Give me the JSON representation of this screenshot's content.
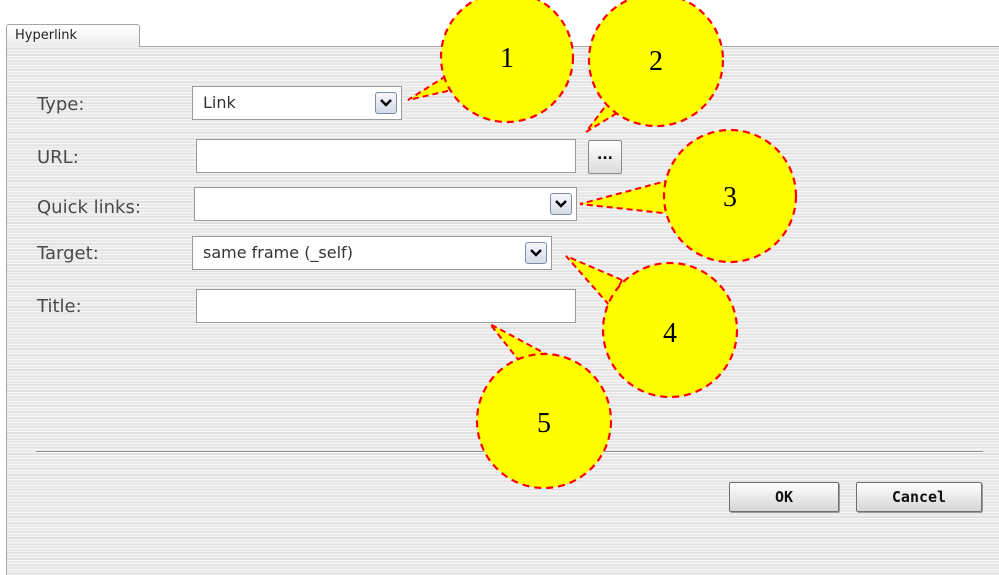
{
  "tab": {
    "label": "Hyperlink"
  },
  "form": {
    "type": {
      "label": "Type:",
      "value": "Link"
    },
    "url": {
      "label": "URL:",
      "value": "",
      "browse_label": "..."
    },
    "quick_links": {
      "label": "Quick links:",
      "value": ""
    },
    "target": {
      "label": "Target:",
      "value": "same frame (_self)"
    },
    "title": {
      "label": "Title:",
      "value": ""
    }
  },
  "buttons": {
    "ok": "OK",
    "cancel": "Cancel"
  },
  "callouts": [
    "1",
    "2",
    "3",
    "4",
    "5"
  ],
  "colors": {
    "callout_fill": "#ffff00",
    "callout_border": "#ff0000",
    "panel_bg": "#e9e9e9"
  }
}
